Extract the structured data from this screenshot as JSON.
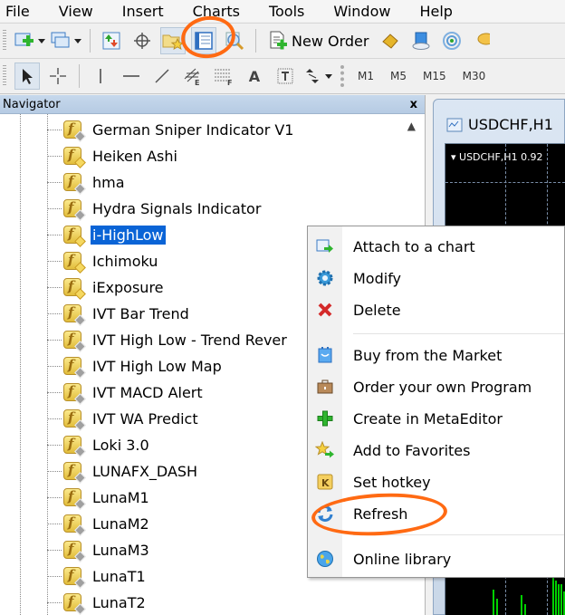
{
  "menubar": {
    "items": [
      "File",
      "View",
      "Insert",
      "Charts",
      "Tools",
      "Window",
      "Help"
    ]
  },
  "toolbar": {
    "new_order_label": "New Order",
    "timeframes": [
      "M1",
      "M5",
      "M15",
      "M30"
    ],
    "text_tool_label": "A"
  },
  "navigator": {
    "title": "Navigator",
    "close_label": "x",
    "items": [
      {
        "label": "German Sniper Indicator V1",
        "selected": false
      },
      {
        "label": "Heiken Ashi",
        "selected": false
      },
      {
        "label": "hma",
        "selected": false
      },
      {
        "label": "Hydra Signals Indicator",
        "selected": false
      },
      {
        "label": "i-HighLow",
        "selected": true
      },
      {
        "label": "Ichimoku",
        "selected": false
      },
      {
        "label": "iExposure",
        "selected": false
      },
      {
        "label": "IVT Bar Trend",
        "selected": false
      },
      {
        "label": "IVT High Low - Trend Rever",
        "selected": false
      },
      {
        "label": "IVT High Low Map",
        "selected": false
      },
      {
        "label": "IVT MACD Alert",
        "selected": false
      },
      {
        "label": "IVT WA Predict",
        "selected": false
      },
      {
        "label": "Loki 3.0",
        "selected": false
      },
      {
        "label": "LUNAFX_DASH",
        "selected": false
      },
      {
        "label": "LunaM1",
        "selected": false
      },
      {
        "label": "LunaM2",
        "selected": false
      },
      {
        "label": "LunaM3",
        "selected": false
      },
      {
        "label": "LunaT1",
        "selected": false
      },
      {
        "label": "LunaT2",
        "selected": false
      }
    ]
  },
  "chart_window": {
    "title": "USDCHF,H1",
    "info_label": "▾ USDCHF,H1  0.92"
  },
  "context_menu": {
    "items": [
      {
        "label": "Attach to a chart",
        "icon": "attach-chart-icon"
      },
      {
        "label": "Modify",
        "icon": "gear-icon"
      },
      {
        "label": "Delete",
        "icon": "delete-x-icon"
      },
      {
        "label": "Buy from the Market",
        "icon": "market-bag-icon"
      },
      {
        "label": "Order your own Program",
        "icon": "briefcase-icon"
      },
      {
        "label": "Create in MetaEditor",
        "icon": "green-plus-icon"
      },
      {
        "label": "Add to Favorites",
        "icon": "star-favorite-icon"
      },
      {
        "label": "Set hotkey",
        "icon": "hotkey-k-icon"
      },
      {
        "label": "Refresh",
        "icon": "refresh-icon"
      },
      {
        "label": "Online library",
        "icon": "globe-icon"
      }
    ]
  },
  "colors": {
    "selection": "#0a64d6",
    "annotation": "#ff6a13",
    "chart_bg": "#000000",
    "chart_bars": "#00d000"
  }
}
